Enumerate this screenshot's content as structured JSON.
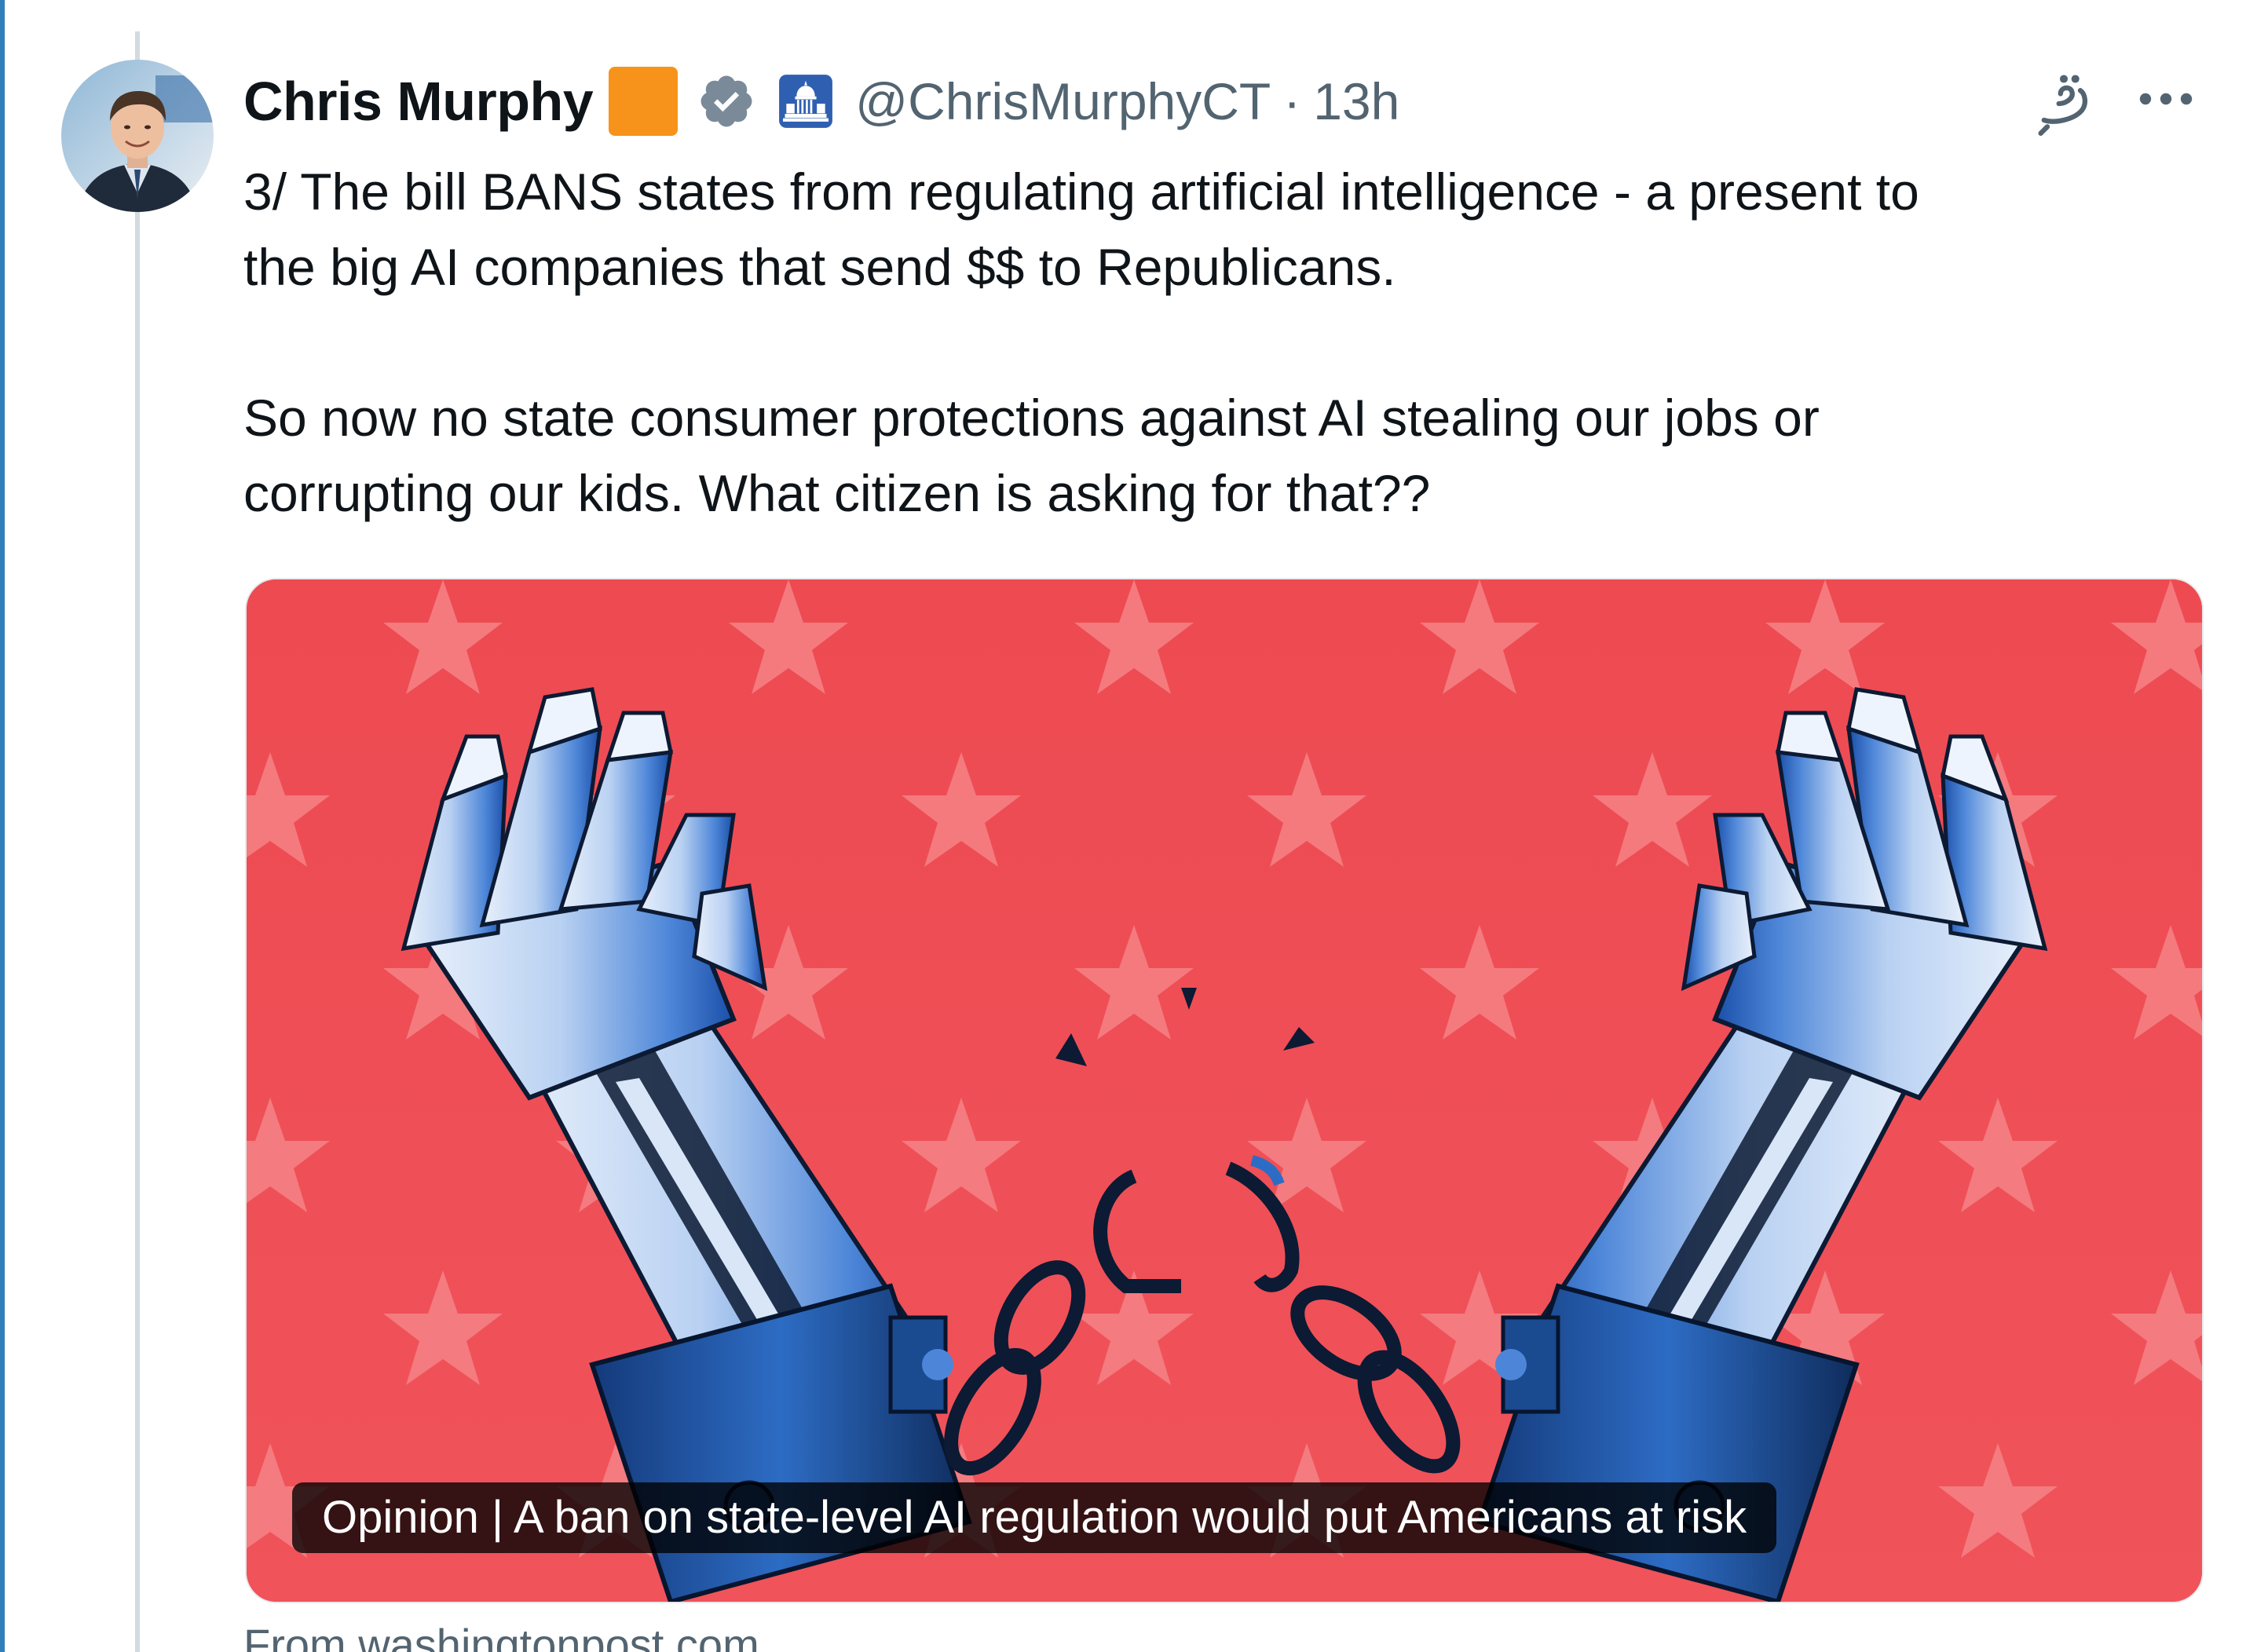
{
  "tweet": {
    "author_name": "Chris Murphy",
    "handle": "@ChrisMurphyCT",
    "separator": "·",
    "time": "13h",
    "text_paragraph_1": "3/ The bill BANS states from regulating artificial intelligence - a present to\nthe big AI companies that send $$ to Republicans.",
    "text_paragraph_2": "So now no state consumer protections against AI stealing our jobs or\ncorrupting our kids. What citizen is asking for that??"
  },
  "badges": {
    "affiliate_badge_color": "#f7931a",
    "verified_icon": "verified-badge-icon",
    "government_icon": "capitol-building-icon"
  },
  "actions": {
    "grok_icon": "grok-icon",
    "more_icon": "more-options-icon"
  },
  "link_card": {
    "caption": "Opinion | A ban on state-level AI regulation would put Americans at risk",
    "source": "From washingtonpost.com",
    "image_description_icon": "robot-hands-breaking-chains-illustration",
    "background_color": "#ee4a52"
  },
  "colors": {
    "text_primary": "#0f1419",
    "text_secondary": "#536471",
    "verified_blue": "#1d9bf0",
    "thread_line": "#d3dae0"
  }
}
